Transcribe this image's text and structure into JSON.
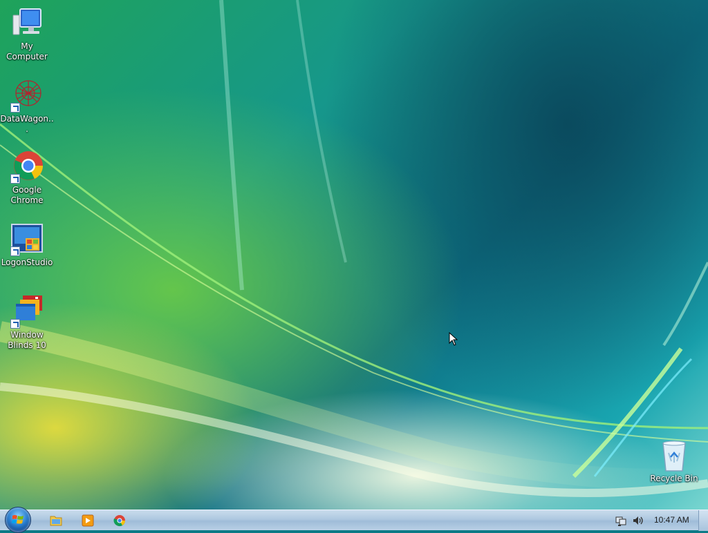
{
  "desktop": {
    "icons": [
      {
        "label": "My Computer"
      },
      {
        "label": "DataWagon..."
      },
      {
        "label": "Google Chrome"
      },
      {
        "label": "LogonStudio"
      },
      {
        "label": "Window Blinds 10"
      },
      {
        "label": "Recycle Bin"
      }
    ]
  },
  "taskbar": {
    "pinned": [
      "file-explorer-icon",
      "media-player-icon",
      "chrome-icon"
    ],
    "clock": "10:47 AM"
  }
}
